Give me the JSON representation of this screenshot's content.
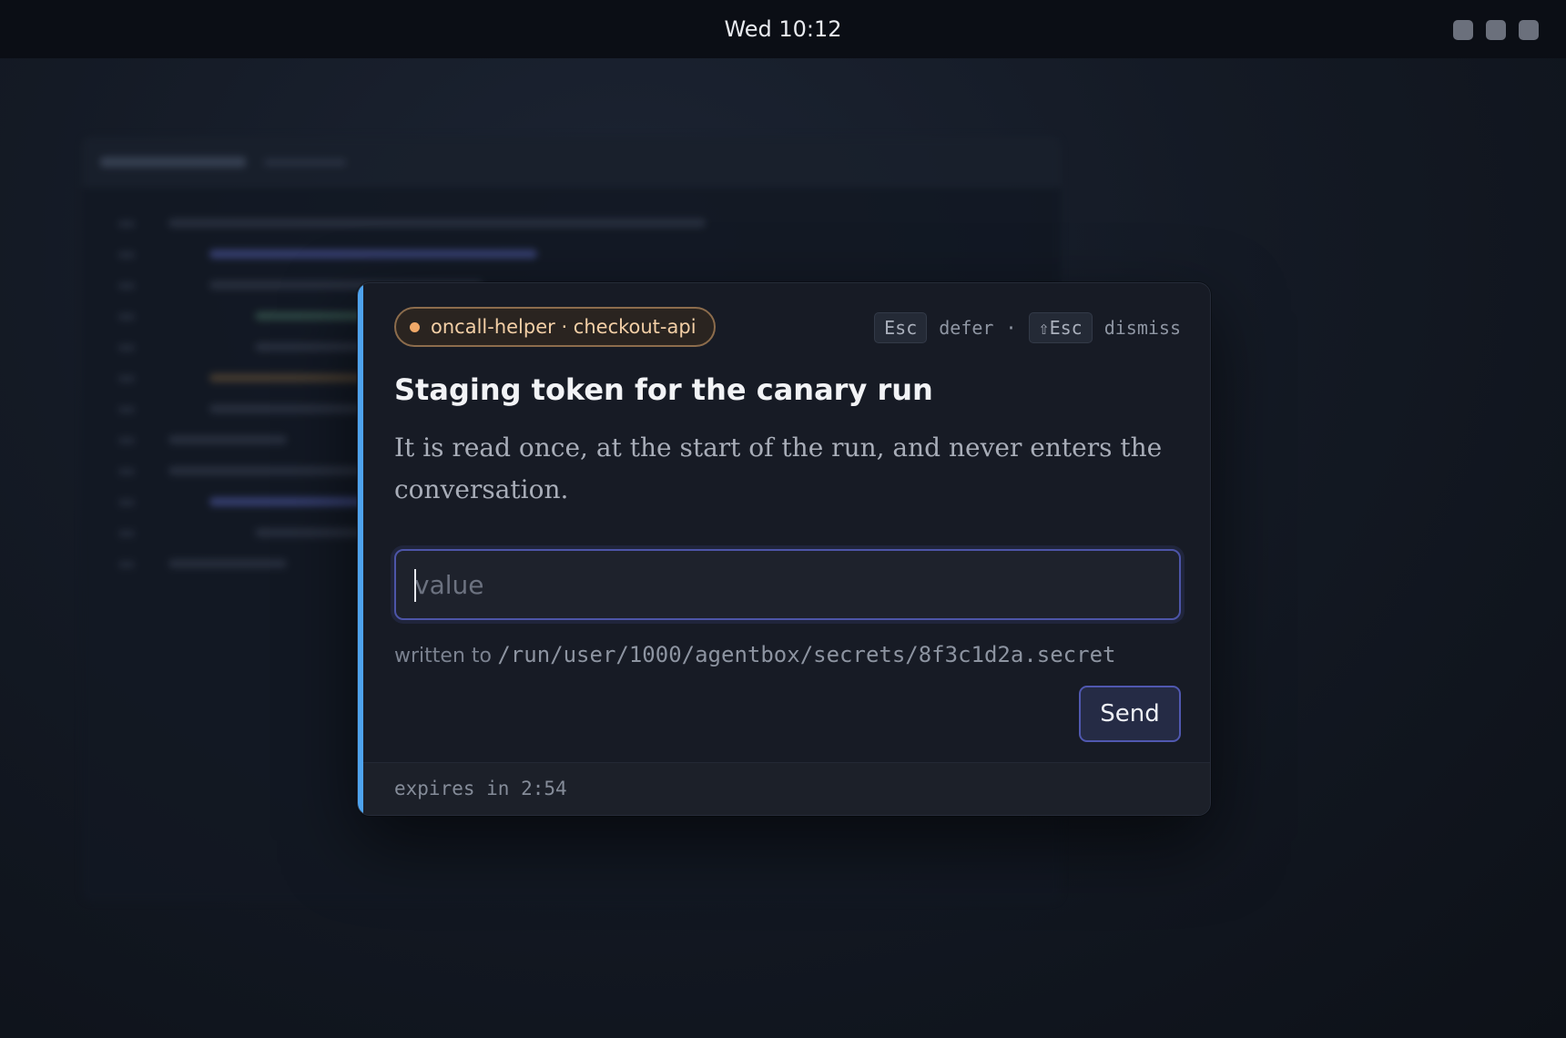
{
  "topbar": {
    "clock": "Wed 10:12",
    "tray_icons": [
      "tray-square-icon",
      "tray-square-icon",
      "tray-square-icon"
    ]
  },
  "prompt": {
    "source_chip": "oncall-helper · checkout-api",
    "shortcuts": {
      "defer_key": "Esc",
      "defer_label": "defer",
      "separator": "·",
      "dismiss_key": "⇧Esc",
      "dismiss_label": "dismiss"
    },
    "title": "Staging token for the canary run",
    "description": "It is read once, at the start of the run, and never enters the conversation.",
    "input": {
      "value": "",
      "placeholder": "value"
    },
    "destination_label": "written to",
    "destination_path": "/run/user/1000/agentbox/secrets/8f3c1d2a.secret",
    "send_label": "Send",
    "expires": "expires in 2:54"
  },
  "colors": {
    "accent": "#4ea3ee",
    "chip_dot": "#f0a868",
    "input_border": "#4d55a8"
  }
}
